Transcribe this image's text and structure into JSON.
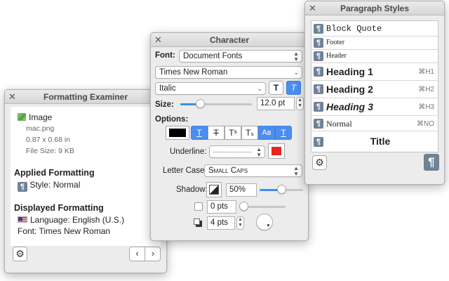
{
  "formatting_examiner": {
    "title": "Formatting Examiner",
    "close_glyph": "✕",
    "image_label": "Image",
    "file_name": "mac.png",
    "dimensions": "0.87 x 0.68 in",
    "file_size": "File Size: 9 KB",
    "applied_heading": "Applied Formatting",
    "style_value": "Style: Normal",
    "displayed_heading": "Displayed Formatting",
    "language_value": "Language: English (U.S.)",
    "font_value": "Font: Times New Roman",
    "icons": [
      "close-icon",
      "image-icon",
      "paragraph-style-icon",
      "us-flag-icon",
      "gear-icon",
      "chevron-left-icon",
      "chevron-right-icon"
    ]
  },
  "character": {
    "title": "Character",
    "close_glyph": "✕",
    "font_label": "Font:",
    "font_collection": "Document Fonts",
    "font_family": "Times New Roman",
    "font_style": "Italic",
    "bold_glyph": "T",
    "italic_glyph": "T",
    "size_label": "Size:",
    "size_value": "12.0 pt",
    "size_slider_fraction": 0.28,
    "options_label": "Options:",
    "options": [
      {
        "name": "underline",
        "glyph": "T",
        "on": true
      },
      {
        "name": "strikethrough",
        "glyph": "T",
        "on": false
      },
      {
        "name": "superscript",
        "glyph": "Tˢ",
        "on": false
      },
      {
        "name": "subscript",
        "glyph": "Tₛ",
        "on": false
      },
      {
        "name": "small-caps",
        "glyph": "Aʙ",
        "on": true
      },
      {
        "name": "outline",
        "glyph": "T",
        "on": true
      }
    ],
    "text_color": "#000000",
    "underline_label": "Underline:",
    "underline_color": "#e8251f",
    "letter_case_label": "Letter Case:",
    "letter_case_value": "Small Caps",
    "shadow_label": "Shadow:",
    "shadow_opacity": "50%",
    "shadow_opacity_fraction": 0.5,
    "shadow_blur": "0 pts",
    "shadow_offset": "4 pts",
    "accent": "#3d8ff0"
  },
  "paragraph_styles": {
    "title": "Paragraph Styles",
    "close_glyph": "✕",
    "styles": [
      {
        "name": "Block Quote",
        "key": ""
      },
      {
        "name": "Footer",
        "key": ""
      },
      {
        "name": "Header",
        "key": ""
      },
      {
        "name": "Heading 1",
        "key": "⌘H1"
      },
      {
        "name": "Heading 2",
        "key": "⌘H2"
      },
      {
        "name": "Heading 3",
        "key": "⌘H3"
      },
      {
        "name": "Normal",
        "key": "⌘NO"
      },
      {
        "name": "Title",
        "key": ""
      }
    ]
  }
}
